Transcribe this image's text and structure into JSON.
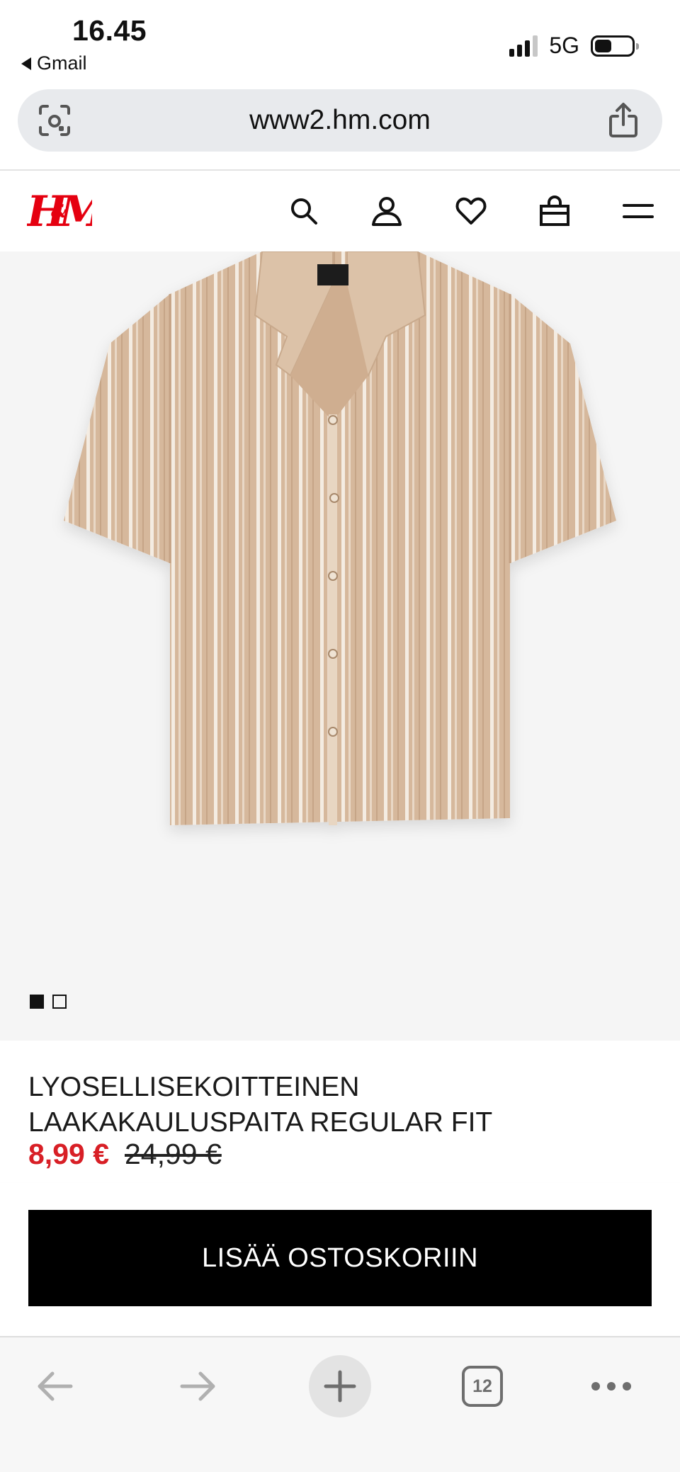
{
  "status_bar": {
    "time": "16.45",
    "back_app": "Gmail",
    "network": "5G",
    "signal_bars": 3,
    "signal_total": 4,
    "battery_level": 0.45
  },
  "browser": {
    "url": "www2.hm.com",
    "tabs_count": "12"
  },
  "site": {
    "brand_color": "#e50010",
    "header_icons": [
      "search-icon",
      "account-icon",
      "heart-icon",
      "bag-icon",
      "menu-icon"
    ]
  },
  "gallery": {
    "total_images": 2,
    "active_index": 0
  },
  "product": {
    "name_line1": "LYOSELLISEKOITTEINEN",
    "name_line2": "LAAKAKAULUSPAITA REGULAR FIT",
    "sale_price": "8,99 €",
    "original_price": "24,99 €",
    "sale_color": "#d81f26"
  },
  "cta": {
    "add_to_cart": "LISÄÄ OSTOSKORIIN"
  },
  "toolbar": {
    "icons": [
      "back-arrow-icon",
      "forward-arrow-icon",
      "new-tab-icon",
      "tabs-icon",
      "more-icon"
    ]
  }
}
